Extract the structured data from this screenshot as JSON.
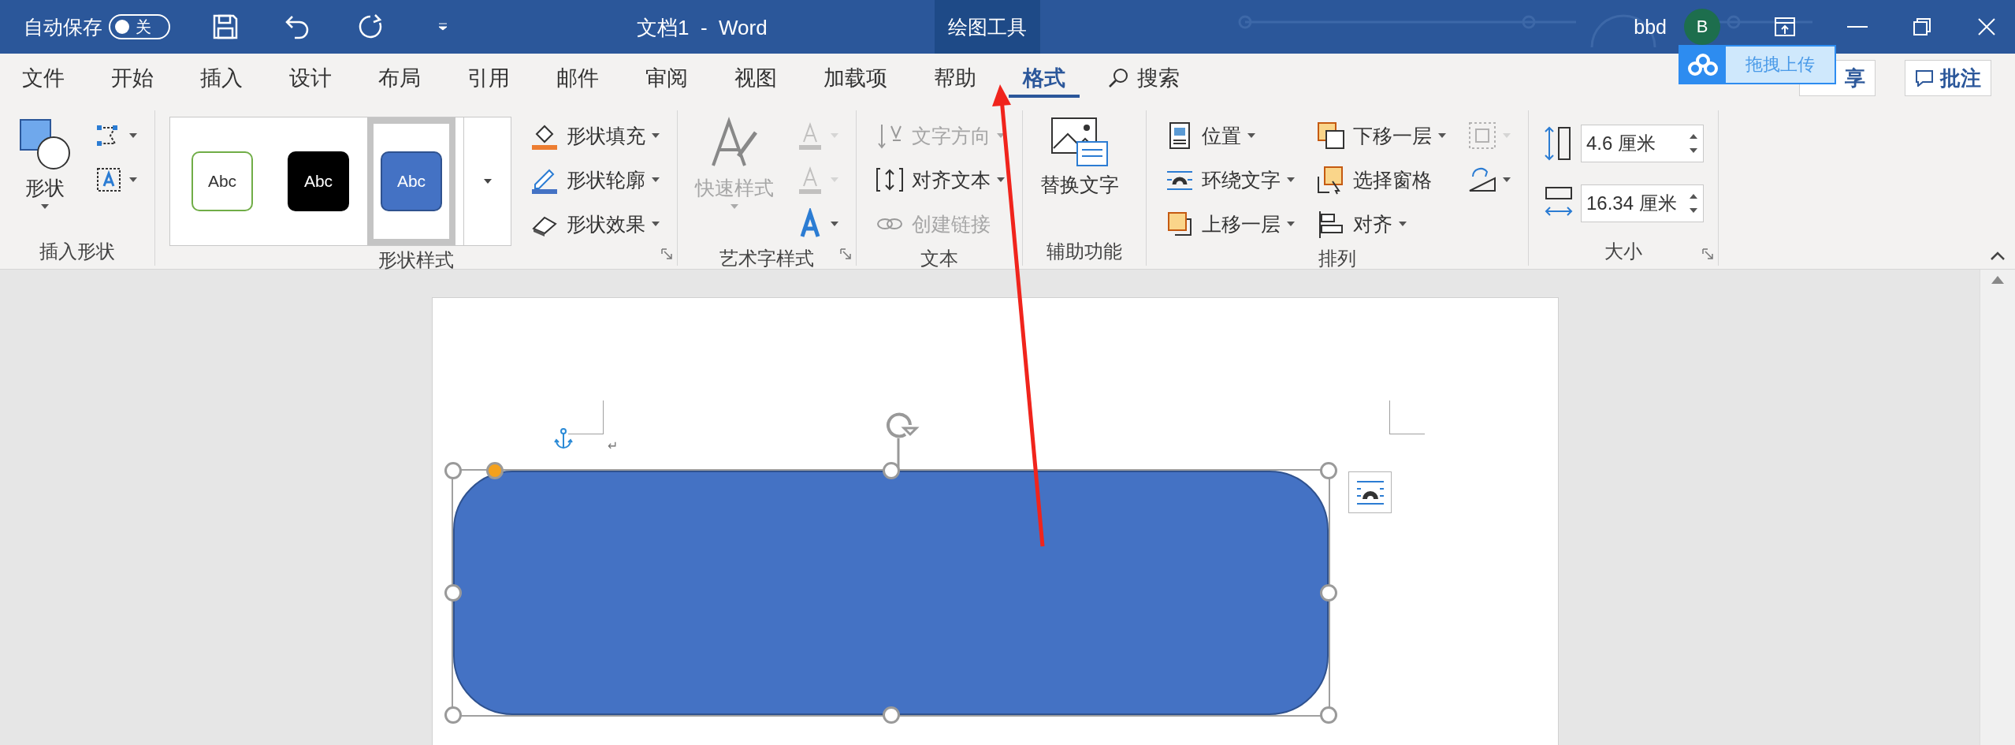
{
  "title_bar": {
    "autosave_label": "自动保存",
    "autosave_on": false,
    "autosave_state": "关",
    "title": "文档1  -  Word",
    "context_tab": "绘图工具",
    "user": "bbd",
    "avatar_initial": "B"
  },
  "tabs": [
    {
      "label": "文件",
      "selected": false
    },
    {
      "label": "开始",
      "selected": false
    },
    {
      "label": "插入",
      "selected": false
    },
    {
      "label": "设计",
      "selected": false
    },
    {
      "label": "布局",
      "selected": false
    },
    {
      "label": "引用",
      "selected": false
    },
    {
      "label": "邮件",
      "selected": false
    },
    {
      "label": "审阅",
      "selected": false
    },
    {
      "label": "视图",
      "selected": false
    },
    {
      "label": "加载项",
      "selected": false
    },
    {
      "label": "帮助",
      "selected": false
    },
    {
      "label": "格式",
      "selected": true
    }
  ],
  "search": {
    "label": "搜索"
  },
  "upload_popup": {
    "label": "拖拽上传"
  },
  "share_button": {
    "label": "享"
  },
  "comment_button": {
    "label": "批注"
  },
  "ribbon_groups": [
    {
      "label": "插入形状",
      "launcher": false,
      "columns": [
        [
          {
            "kind": "large",
            "label": "形状",
            "disabled": false,
            "dropdown": true
          }
        ],
        [
          {
            "kind": "icon",
            "disabled": false,
            "dropdown": true
          },
          {
            "kind": "icon",
            "disabled": false,
            "dropdown": true
          }
        ]
      ]
    },
    {
      "label": "形状样式",
      "launcher": true,
      "columns": [
        [
          {
            "kind": "gallery",
            "swatches": [
              {
                "label": "Abc",
                "selected": false
              },
              {
                "label": "Abc",
                "selected": false
              },
              {
                "label": "Abc",
                "selected": true
              }
            ]
          }
        ],
        [
          {
            "kind": "small",
            "label": "形状填充",
            "disabled": false,
            "dropdown": true
          },
          {
            "kind": "small",
            "label": "形状轮廓",
            "disabled": false,
            "dropdown": true
          },
          {
            "kind": "small",
            "label": "形状效果",
            "disabled": false,
            "dropdown": true
          }
        ]
      ]
    },
    {
      "label": "艺术字样式",
      "launcher": true,
      "columns": [
        [
          {
            "kind": "large",
            "label": "快速样式",
            "disabled": true,
            "dropdown": true
          }
        ],
        [
          {
            "kind": "icon",
            "disabled": true,
            "dropdown": true
          },
          {
            "kind": "icon",
            "disabled": true,
            "dropdown": true
          },
          {
            "kind": "icon",
            "disabled": false,
            "dropdown": true
          }
        ]
      ]
    },
    {
      "label": "文本",
      "launcher": false,
      "columns": [
        [
          {
            "kind": "small",
            "label": "文字方向",
            "disabled": true,
            "dropdown": true
          },
          {
            "kind": "small",
            "label": "对齐文本",
            "disabled": false,
            "dropdown": true
          },
          {
            "kind": "small",
            "label": "创建链接",
            "disabled": true,
            "dropdown": false
          }
        ]
      ]
    },
    {
      "label": "辅助功能",
      "launcher": false,
      "columns": [
        [
          {
            "kind": "large",
            "label": "替换文字",
            "disabled": false,
            "dropdown": false
          }
        ]
      ]
    },
    {
      "label": "排列",
      "launcher": false,
      "columns": [
        [
          {
            "kind": "small",
            "label": "位置",
            "disabled": false,
            "dropdown": true
          },
          {
            "kind": "small",
            "label": "环绕文字",
            "disabled": false,
            "dropdown": true
          },
          {
            "kind": "small",
            "label": "上移一层",
            "disabled": false,
            "dropdown": true
          }
        ],
        [
          {
            "kind": "small",
            "label": "下移一层",
            "disabled": false,
            "dropdown": true
          },
          {
            "kind": "small",
            "label": "选择窗格",
            "disabled": false,
            "dropdown": false
          },
          {
            "kind": "small",
            "label": "对齐",
            "disabled": false,
            "dropdown": true
          }
        ],
        [
          {
            "kind": "icon",
            "disabled": true,
            "dropdown": true
          },
          {
            "kind": "icon",
            "disabled": false,
            "dropdown": true
          }
        ]
      ]
    },
    {
      "label": "大小",
      "launcher": true,
      "columns": [
        [
          {
            "kind": "spin",
            "value": "4.6 厘米"
          },
          {
            "kind": "spin",
            "value": "16.34 厘米"
          }
        ]
      ]
    }
  ],
  "document": {
    "paragraph_mark": "↵",
    "shape": {
      "selected": true
    }
  }
}
